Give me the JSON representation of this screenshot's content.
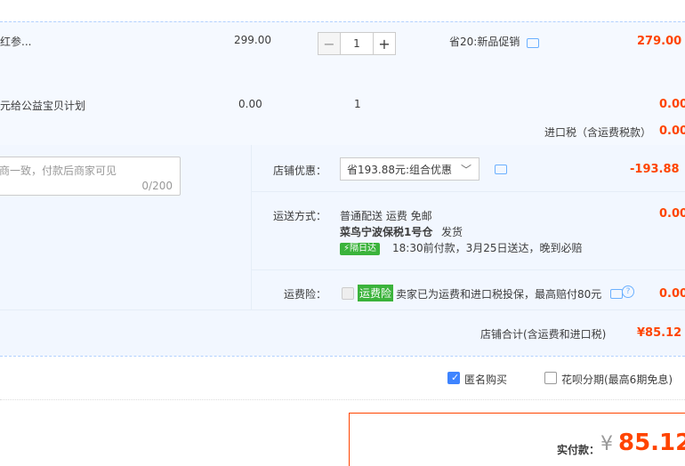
{
  "item1": {
    "name": "红参...",
    "price": "299.00",
    "qty": "1",
    "promo": "省20:新品促销",
    "total": "279.00"
  },
  "item2": {
    "name": "元给公益宝贝计划",
    "price": "0.00",
    "qty": "1",
    "total": "0.00"
  },
  "import_tax": {
    "label": "进口税（含运费税款）",
    "value": "0.00"
  },
  "message": {
    "placeholder": "商一致，付款后商家可见",
    "counter": "0/200"
  },
  "discount": {
    "label": "店铺优惠：",
    "selected": "省193.88元:组合优惠",
    "value": "-193.88"
  },
  "shipping": {
    "label": "运送方式：",
    "method": "普通配送 运费 免邮",
    "warehouse": "菜鸟宁波保税1号仓",
    "dispatch": "发货",
    "badge": "隔日达",
    "promise": "18:30前付款，3月25日送达，晚到必赔",
    "value": "0.00"
  },
  "insurance": {
    "label": "运费险：",
    "badge": "运费险",
    "text": "卖家已为运费和进口税投保，最高赔付80元",
    "value": "0.00"
  },
  "store_total": {
    "label": "店铺合计(含运费和进口税)",
    "value": "¥85.12"
  },
  "options": {
    "anonymous": "匿名购买",
    "huabei": "花呗分期(最高6期免息)"
  },
  "payment": {
    "label": "实付款：",
    "currency": "¥",
    "amount": "85.12"
  }
}
